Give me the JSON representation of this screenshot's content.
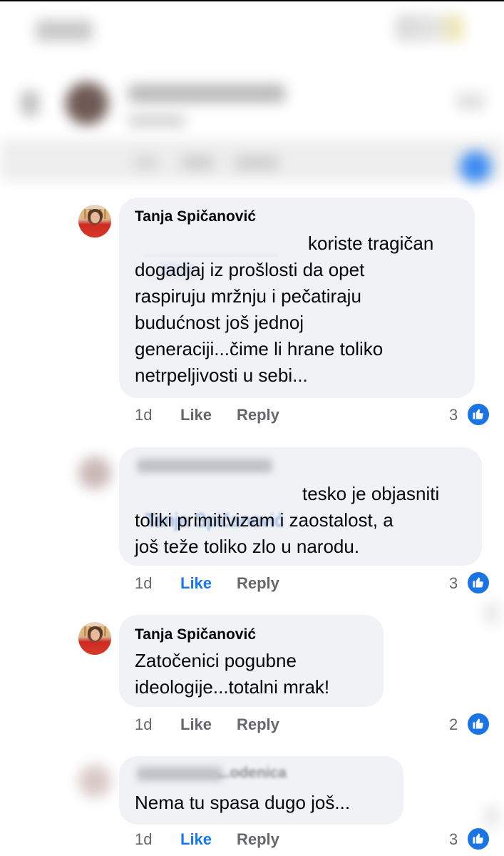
{
  "comments": [
    {
      "author": "Tanja Spičanović",
      "mention": "...nica",
      "lines": [
        "koriste tragičan",
        "dogadjaj iz prošlosti da opet",
        "raspiruju mržnju i pečatiraju",
        "budućnost još jednoj",
        "generaciji...čime li hrane toliko",
        "netrpeljivosti u sebi..."
      ],
      "time": "1d",
      "like": "Like",
      "reply": "Reply",
      "count": "3"
    },
    {
      "author": "",
      "mention": "Tanja Spičanović",
      "lines": [
        "tesko je objasniti",
        "toliki primitivizam i zaostalost, a",
        "još teže toliko zlo u narodu."
      ],
      "time": "1d",
      "like": "Like",
      "reply": "Reply",
      "count": "3"
    },
    {
      "author": "Tanja Spičanović",
      "lines": [
        "Zatočenici pogubne",
        "ideologije...totalni mrak!"
      ],
      "time": "1d",
      "like": "Like",
      "reply": "Reply",
      "count": "2"
    },
    {
      "author": "...odenica",
      "lines": [
        "Nema tu spasa dugo još..."
      ],
      "time": "1d",
      "like": "Like",
      "reply": "Reply",
      "count": "3"
    }
  ],
  "colors": {
    "like_active": "#1877f2",
    "bubble": "#f0f2f5",
    "meta": "#65676b"
  },
  "icons": {
    "reaction": "thumbs-up-icon"
  }
}
